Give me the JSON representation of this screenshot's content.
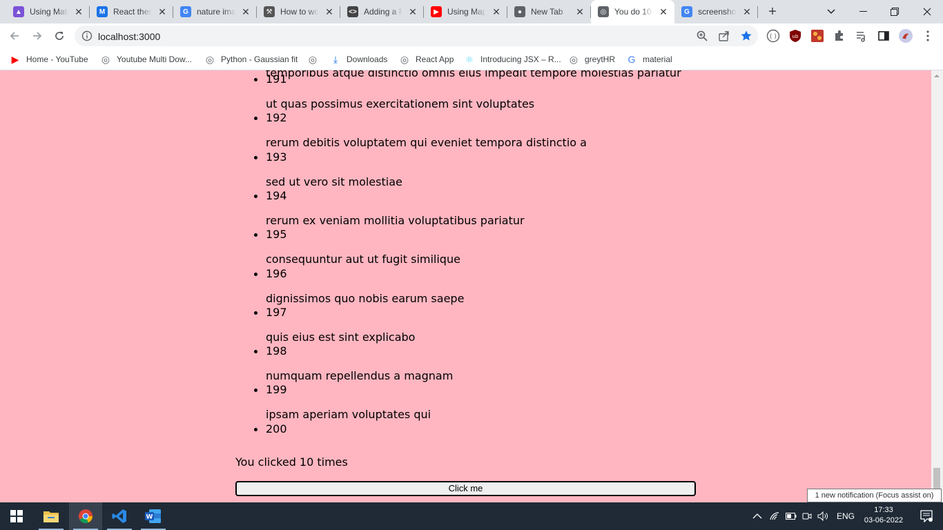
{
  "browser": {
    "tabs": [
      {
        "title": "Using Material",
        "favicon": "material-icon",
        "color": "#7b52d8"
      },
      {
        "title": "React theme",
        "favicon": "mui-icon",
        "color": "#1a73e8"
      },
      {
        "title": "nature images",
        "favicon": "google-icon",
        "color": "#4285f4"
      },
      {
        "title": "How to work",
        "favicon": "tools-icon",
        "color": "#555555"
      },
      {
        "title": "Adding a Map",
        "favicon": "code-icon",
        "color": "#444444"
      },
      {
        "title": "Using Map",
        "favicon": "youtube-icon",
        "color": "#ff0000"
      },
      {
        "title": "New Tab",
        "favicon": "chrome-icon",
        "color": "#5f6368"
      },
      {
        "title": "You do 10",
        "favicon": "globe-icon",
        "color": "#5f6368"
      },
      {
        "title": "screenshot",
        "favicon": "google-icon",
        "color": "#4285f4"
      }
    ],
    "active_tab_index": 7,
    "url": "localhost:3000",
    "bookmarks": [
      {
        "label": "Home - YouTube",
        "icon": "youtube-icon"
      },
      {
        "label": "Youtube Multi Dow...",
        "icon": "globe-icon"
      },
      {
        "label": "Python - Gaussian fit",
        "icon": "globe-icon"
      },
      {
        "label": "",
        "icon": "globe-icon"
      },
      {
        "label": "Downloads",
        "icon": "download-icon"
      },
      {
        "label": "React App",
        "icon": "globe-icon"
      },
      {
        "label": "Introducing JSX – R...",
        "icon": "react-icon"
      },
      {
        "label": "greytHR",
        "icon": "globe-icon"
      },
      {
        "label": "material",
        "icon": "google-icon"
      }
    ]
  },
  "page": {
    "background": "#ffb6c1",
    "partial_top_title": "temporibus atque distinctio omnis eius impedit tempore molestias pariatur",
    "posts": [
      {
        "id": "191",
        "title": "ut quas possimus exercitationem sint voluptates"
      },
      {
        "id": "192",
        "title": "rerum debitis voluptatem qui eveniet tempora distinctio a"
      },
      {
        "id": "193",
        "title": "sed ut vero sit molestiae"
      },
      {
        "id": "194",
        "title": "rerum ex veniam mollitia voluptatibus pariatur"
      },
      {
        "id": "195",
        "title": "consequuntur aut ut fugit similique"
      },
      {
        "id": "196",
        "title": "dignissimos quo nobis earum saepe"
      },
      {
        "id": "197",
        "title": "quis eius est sint explicabo"
      },
      {
        "id": "198",
        "title": "numquam repellendus a magnam"
      },
      {
        "id": "199",
        "title": "ipsam aperiam voluptates qui"
      },
      {
        "id": "200",
        "title": ""
      }
    ],
    "counter_text": "You clicked 10 times",
    "button_label": "Click me"
  },
  "notification": "1 new notification (Focus assist on)",
  "taskbar": {
    "apps": [
      "windows-start-icon",
      "file-explorer-icon",
      "chrome-icon",
      "vscode-icon",
      "word-icon"
    ],
    "language": "ENG",
    "time": "17:33",
    "date": "03-06-2022"
  }
}
